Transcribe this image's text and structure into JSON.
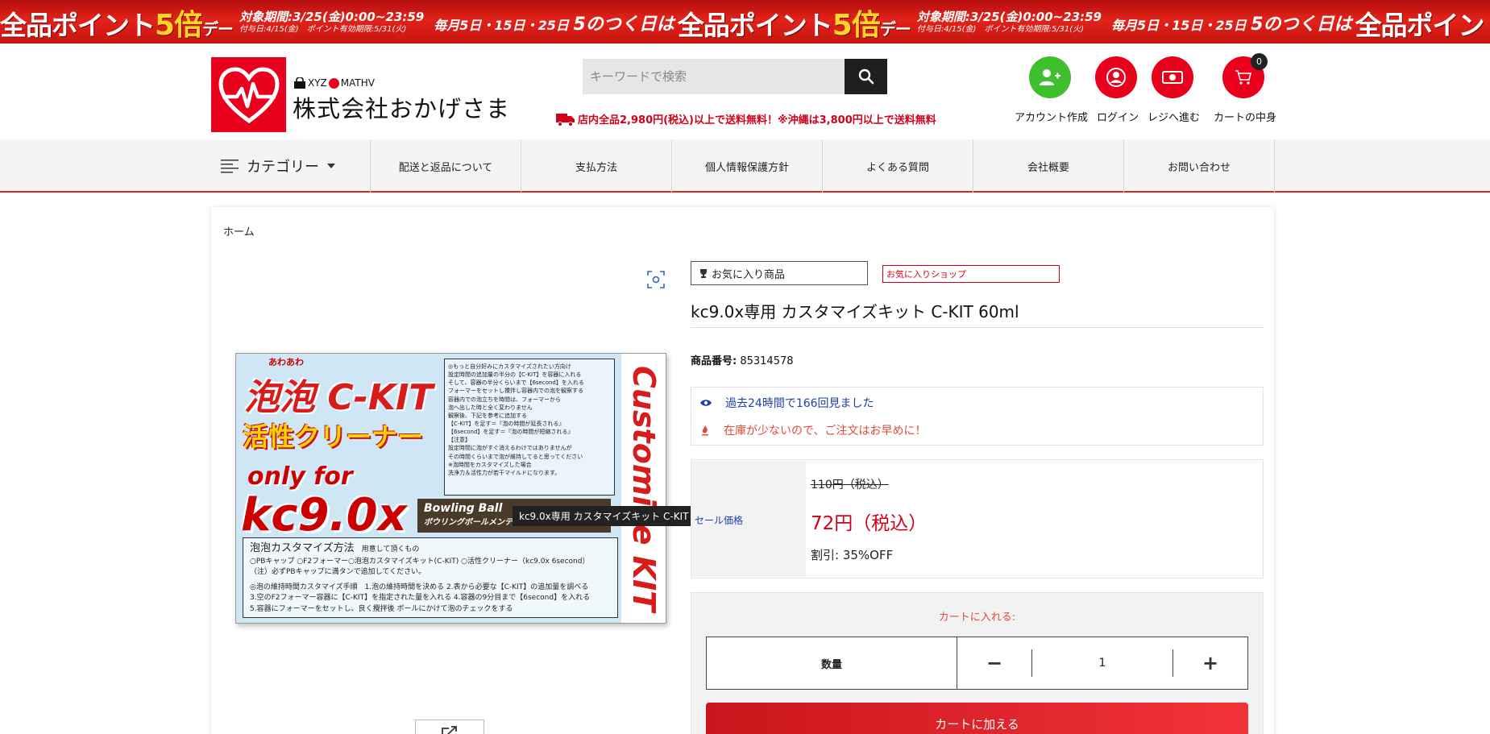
{
  "promo": {
    "headline": "全品ポイント",
    "multiplier": "5倍",
    "day_suffix": "デー",
    "period": "対象期間:3/25(金)0:00~23:59",
    "grant_info": "付与日:4/15(金)　ポイント有効期限:5/31(火)",
    "every_month": "毎月",
    "dates": "5日・15日・25日",
    "five_days": "5のつく日は",
    "headline_tail": "全品ポイント"
  },
  "brand": {
    "small_prefix": "XYZ",
    "small_suffix": "MATHV",
    "name": "株式会社おかげさま"
  },
  "search": {
    "placeholder": "キーワードで検索"
  },
  "shipping_notice": "店内全品2,980円(税込)以上で送料無料！※沖縄は3,800円以上で送料無料",
  "header_actions": {
    "account": "アカウント作成",
    "login": "ログイン",
    "checkout": "レジへ進む",
    "cart": "カートの中身",
    "cart_count": "0"
  },
  "colors": {
    "accent_red": "#e2231a",
    "account_green": "#3fbf2e",
    "link_blue": "#1f3fa8"
  },
  "nav": {
    "category": "カテゴリー",
    "items": [
      "配送と返品について",
      "支払方法",
      "個人情報保護方針",
      "よくある質問",
      "会社概要",
      "お問い合わせ"
    ]
  },
  "breadcrumb": "ホーム",
  "product": {
    "fav_item": "お気に入り商品",
    "fav_shop": "お気に入りショップ",
    "title": "kc9.0x専用 カスタマイズキット C-KIT 60ml",
    "code_label": "商品番号:",
    "code_value": "85314578",
    "views_alert": "過去24時間で166回見ました",
    "stock_alert": "在庫が少ないので、ご注文はお早めに！",
    "sale_label": "セール価格",
    "old_price": "110円（税込）",
    "new_price": "72円（税込）",
    "discount": "割引: 35%OFF",
    "cart_title": "カートに入れる:",
    "qty_label": "数量",
    "qty_minus": "−",
    "qty_value": "1",
    "qty_plus": "+",
    "add_to_cart": "カートに加える",
    "tooltip": "kc9.0x専用 カスタマイズキット C-KIT 60ml"
  },
  "product_image": {
    "title_ruby": "あわあわ",
    "title1": "泡泡 C-KIT",
    "title2": "活性クリーナー",
    "only_for": "only for",
    "model": "kc9.0x",
    "side": "Customize KIT",
    "bowling": "Bowling Ball",
    "bowling_sub": "ボウリングボールメンテ",
    "notes": [
      "◎もっと自分好みにカスタマイズされたい方向け",
      "設定時間の追加量の半分の【C-KIT】を容器に入れる",
      "そして、容器の半分くらいまで【6second】を入れる",
      "フォーマーをセットし攪拌し容器内での泡を観察する",
      "容器内での泡立ちを時間は、フォーマーから",
      "泡へ出した時と全く変わりません",
      "観察後、下記を参考に追加する",
      "【C-KIT】を足す＝『泡の時間が延長される』",
      "【6second】を足す＝『泡の時間が短縮される』",
      "【注意】",
      "設定時間に泡がすぐ消えるわけではありませんが",
      "その時間くらいまで泡が維持してると思ってください",
      "※泡時間をカスタマイズした場合",
      "洗浄力＆活性力が若干マイルドになります。"
    ],
    "method_title": "泡泡カスタマイズ方法",
    "method_sub": "用意して頂くもの",
    "method_items": "○PBキャップ ○F2フォーマー○泡泡カスタマイズキット(C-KIT) ○活性クリーナー（kc9.0x 6second）",
    "method_note": "（注）必ずPBキャップに満タンで追加してください。",
    "steps1": "◎泡の維持時間カスタマイズ手順　1.泡の維持時間を決める 2.表から必要な【C-KIT】の追加量を調べる",
    "steps2": "3.空のF2フォーマー容器に【C-KIT】を指定された量を入れる 4.容器の9分目まで【6second】を入れる",
    "steps3": "5.容器にフォーマーをセットし、良く攪拌後 ボールにかけて泡のチェックをする"
  }
}
